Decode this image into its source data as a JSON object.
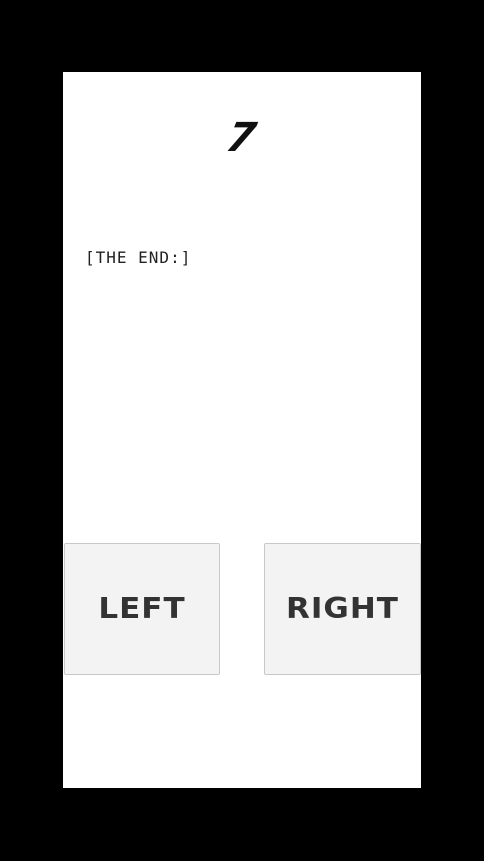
{
  "score": "7",
  "message": "[THE END:]",
  "controls": {
    "left_label": "LEFT",
    "right_label": "RIGHT"
  },
  "colors": {
    "background": "#000000",
    "stage": "#ffffff",
    "button": "#f3f3f3",
    "text": "#333333"
  }
}
